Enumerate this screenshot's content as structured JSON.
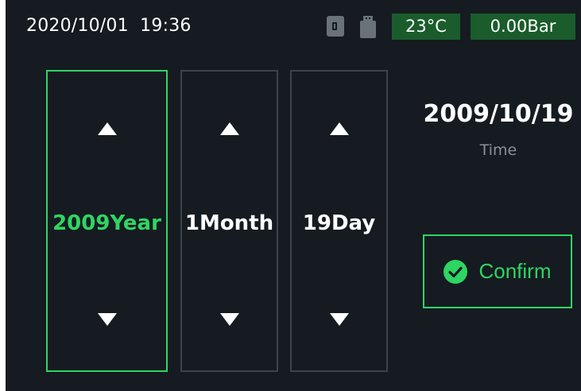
{
  "status_bar": {
    "datetime": "2020/10/01  19:36",
    "temperature": "23°C",
    "pressure": "0.00Bar",
    "icons": [
      "sd-card-icon",
      "usb-drive-icon"
    ]
  },
  "pickers": {
    "year": {
      "label": "2009Year"
    },
    "month": {
      "label": "1Month"
    },
    "day": {
      "label": "19Day"
    }
  },
  "selection": {
    "date": "2009/10/19",
    "caption": "Time"
  },
  "confirm": {
    "label": "Confirm",
    "icon": "check-circle-icon"
  },
  "colors": {
    "background": "#151b21",
    "accent": "#2fd562",
    "badge": "#1a5c2b",
    "border": "#3d434a"
  }
}
